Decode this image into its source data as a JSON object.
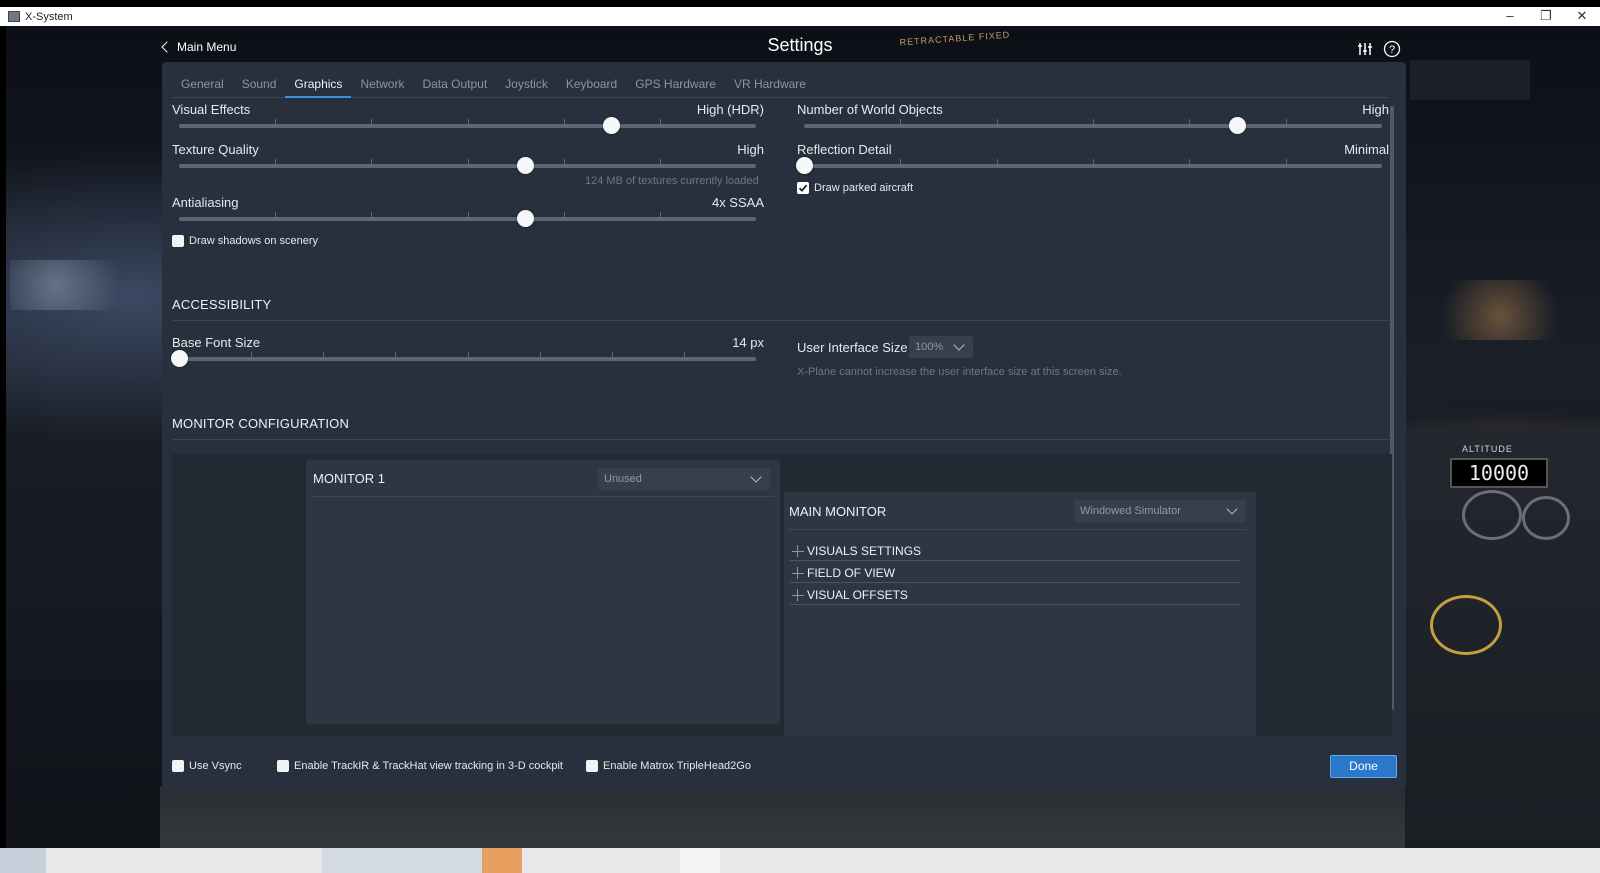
{
  "window": {
    "title": "X-System",
    "minimize_glyph": "–",
    "maximize_glyph": "❐",
    "close_glyph": "✕"
  },
  "header": {
    "back_label": "Main Menu",
    "title": "Settings",
    "icons": [
      "sliders-icon",
      "help-icon"
    ]
  },
  "tabs": [
    {
      "label": "General"
    },
    {
      "label": "Sound"
    },
    {
      "label": "Graphics",
      "active": true
    },
    {
      "label": "Network"
    },
    {
      "label": "Data Output"
    },
    {
      "label": "Joystick"
    },
    {
      "label": "Keyboard"
    },
    {
      "label": "GPS Hardware"
    },
    {
      "label": "VR Hardware"
    }
  ],
  "graphics": {
    "visual_effects": {
      "label": "Visual Effects",
      "value": "High (HDR)",
      "level": 0.75
    },
    "texture_quality": {
      "label": "Texture Quality",
      "value": "High",
      "level": 0.6,
      "note": "124 MB of textures currently loaded"
    },
    "antialiasing": {
      "label": "Antialiasing",
      "value": "4x SSAA",
      "level": 0.6
    },
    "draw_shadows": {
      "label": "Draw shadows on scenery",
      "checked": false
    },
    "world_objects": {
      "label": "Number of World Objects",
      "value": "High",
      "level": 0.75
    },
    "reflection_detail": {
      "label": "Reflection Detail",
      "value": "Minimal",
      "level": 0.0
    },
    "draw_parked_aircraft": {
      "label": "Draw parked aircraft",
      "checked": true
    }
  },
  "accessibility": {
    "title": "ACCESSIBILITY",
    "base_font_size": {
      "label": "Base Font Size",
      "value": "14 px",
      "level": 0.0
    },
    "ui_size": {
      "label": "User Interface Size",
      "value": "100%",
      "note": "X-Plane cannot increase the user interface size at this screen size."
    }
  },
  "monitor_config": {
    "title": "MONITOR CONFIGURATION",
    "monitor1": {
      "title": "MONITOR 1",
      "value": "Unused"
    },
    "main_monitor": {
      "title": "MAIN MONITOR",
      "value": "Windowed Simulator"
    },
    "sections": [
      "VISUALS SETTINGS",
      "FIELD OF VIEW",
      "VISUAL OFFSETS"
    ]
  },
  "footer": {
    "use_vsync": {
      "label": "Use Vsync",
      "checked": false
    },
    "trackir": {
      "label": "Enable TrackIR & TrackHat view tracking in 3-D cockpit",
      "checked": false
    },
    "matrox": {
      "label": "Enable Matrox TripleHead2Go",
      "checked": false
    },
    "done_label": "Done"
  },
  "background": {
    "altitude_label": "ALTITUDE",
    "altitude_value": "10000",
    "sign_text": "RETRACTABLE   FIXED"
  },
  "colors": {
    "panel": "#27303c",
    "accent": "#2a78c9",
    "tab_active_underline": "#3d8fe0"
  }
}
